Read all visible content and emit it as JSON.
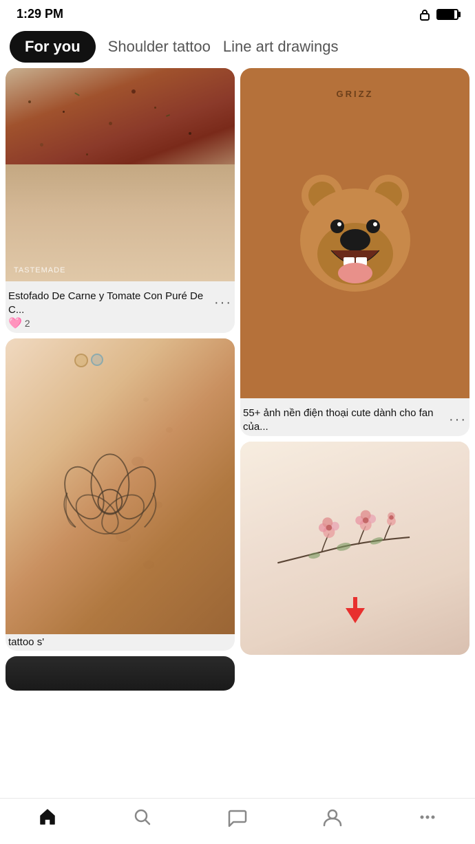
{
  "statusBar": {
    "time": "1:29 PM"
  },
  "tabs": [
    {
      "id": "for-you",
      "label": "For you",
      "active": true
    },
    {
      "id": "shoulder-tattoo",
      "label": "Shoulder tattoo",
      "active": false
    },
    {
      "id": "line-art",
      "label": "Line art drawings",
      "active": false
    }
  ],
  "pins": {
    "left": [
      {
        "id": "meat",
        "watermark": "TASTEMADE",
        "title": "Estofado De Carne y Tomate Con Puré De C...",
        "likes": "2",
        "hasMore": true
      },
      {
        "id": "tattoo",
        "bottomLabel": "tattoo s'",
        "hasMore": false
      }
    ],
    "right": [
      {
        "id": "bear",
        "bearLabel": "GRIZZ",
        "title": "55+ ảnh nền điện thoại cute dành cho fan của...",
        "hasMore": true
      },
      {
        "id": "floral",
        "hasMore": false
      }
    ]
  },
  "navItems": [
    {
      "id": "home",
      "icon": "home",
      "active": true
    },
    {
      "id": "search",
      "icon": "search",
      "active": false
    },
    {
      "id": "messages",
      "icon": "message",
      "active": false
    },
    {
      "id": "profile",
      "icon": "person",
      "active": false
    },
    {
      "id": "more",
      "icon": "dots",
      "active": false
    }
  ]
}
